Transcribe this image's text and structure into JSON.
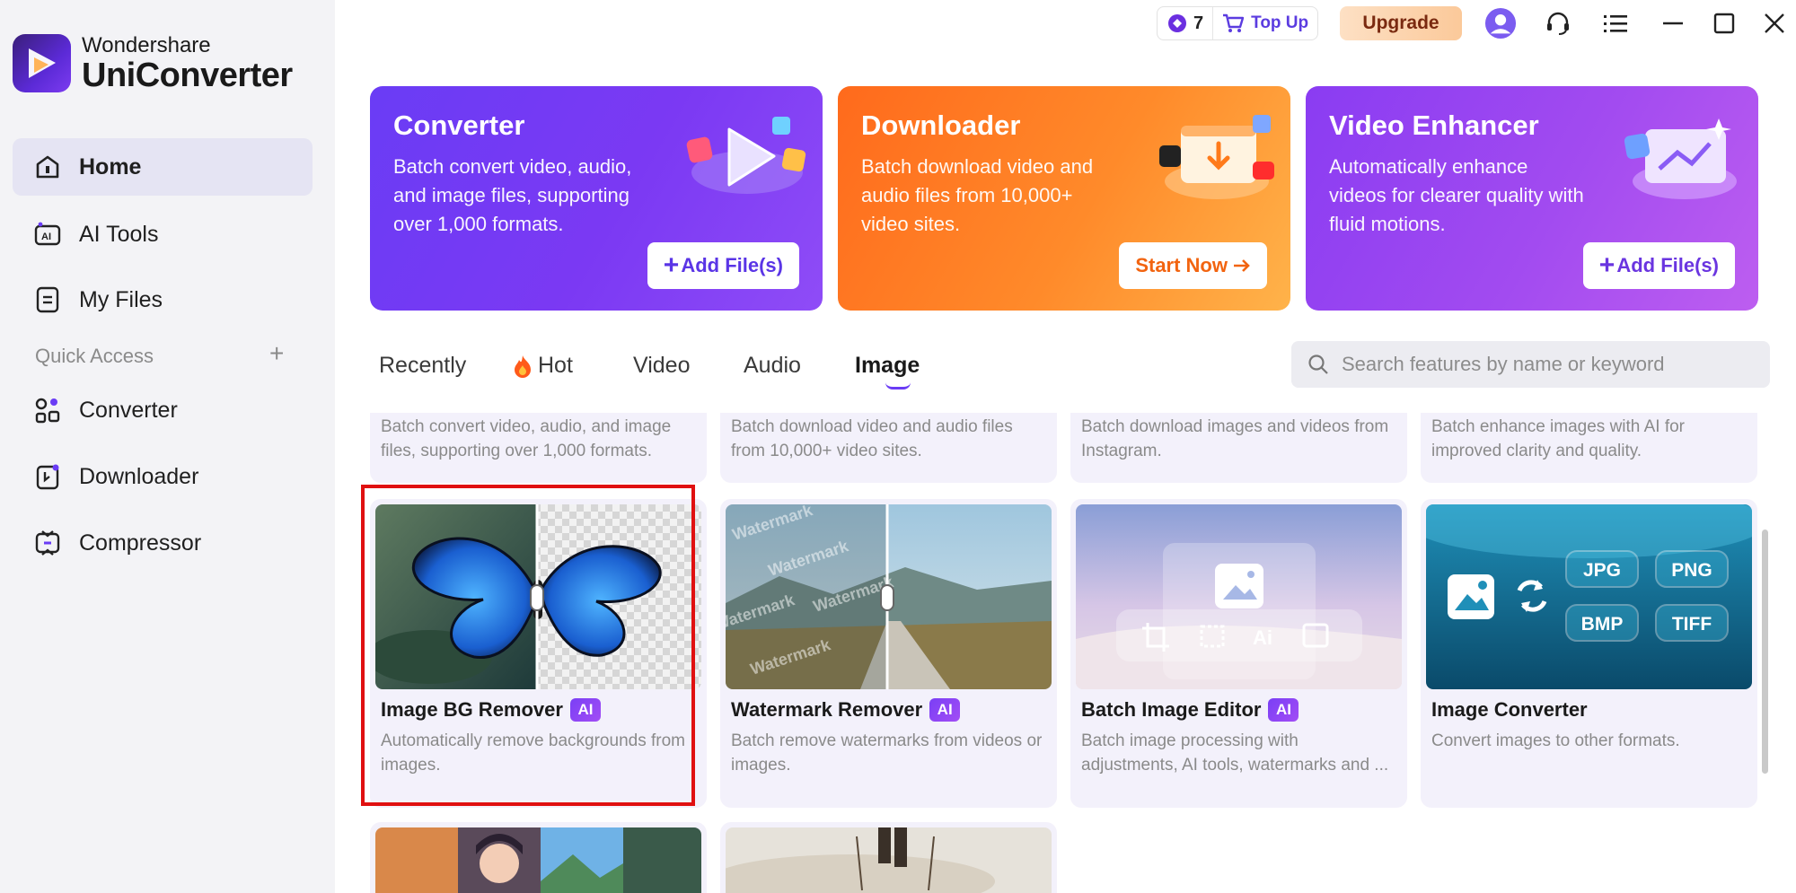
{
  "brand": {
    "small": "Wondershare",
    "big": "UniConverter"
  },
  "sidebar": {
    "items": [
      {
        "label": "Home",
        "icon": "home-icon"
      },
      {
        "label": "AI Tools",
        "icon": "ai-tools-icon"
      },
      {
        "label": "My Files",
        "icon": "my-files-icon"
      }
    ],
    "quick_access_label": "Quick Access",
    "quick_items": [
      {
        "label": "Converter",
        "icon": "converter-icon"
      },
      {
        "label": "Downloader",
        "icon": "downloader-icon"
      },
      {
        "label": "Compressor",
        "icon": "compressor-icon"
      }
    ]
  },
  "topbar": {
    "credits": "7",
    "topup_label": "Top Up",
    "upgrade_label": "Upgrade"
  },
  "hero": [
    {
      "title": "Converter",
      "desc": "Batch convert video, audio, and image files, supporting over 1,000 formats.",
      "button": "Add File(s)"
    },
    {
      "title": "Downloader",
      "desc": "Batch download video and audio files from 10,000+ video sites.",
      "button": "Start Now"
    },
    {
      "title": "Video Enhancer",
      "desc": "Automatically enhance videos for clearer quality with fluid motions.",
      "button": "Add File(s)"
    }
  ],
  "tabs": [
    {
      "label": "Recently"
    },
    {
      "label": "Hot"
    },
    {
      "label": "Video"
    },
    {
      "label": "Audio"
    },
    {
      "label": "Image",
      "active": true
    }
  ],
  "search": {
    "placeholder": "Search features by name or keyword"
  },
  "row1_descs": [
    "Batch convert video, audio, and image files, supporting over 1,000 formats.",
    "Batch download video and audio files from 10,000+ video sites.",
    "Batch download images and videos from Instagram.",
    "Batch enhance images with AI for improved clarity and quality."
  ],
  "features": [
    {
      "title": "Image BG Remover",
      "ai": "AI",
      "desc": "Automatically remove backgrounds from images."
    },
    {
      "title": "Watermark Remover",
      "ai": "AI",
      "desc": "Batch remove watermarks from videos or images."
    },
    {
      "title": "Batch Image Editor",
      "ai": "AI",
      "desc": "Batch image processing with adjustments, AI tools, watermarks and ..."
    },
    {
      "title": "Image Converter",
      "desc": "Convert images to other formats.",
      "formats": [
        "JPG",
        "PNG",
        "BMP",
        "TIFF"
      ]
    }
  ],
  "watermark_text": "Watermark",
  "colors": {
    "accent": "#6a3cf5",
    "converter": "#7b39f3",
    "downloader": "#ff8a2a",
    "enhancer": "#a24bf0",
    "highlight": "#e01010"
  }
}
